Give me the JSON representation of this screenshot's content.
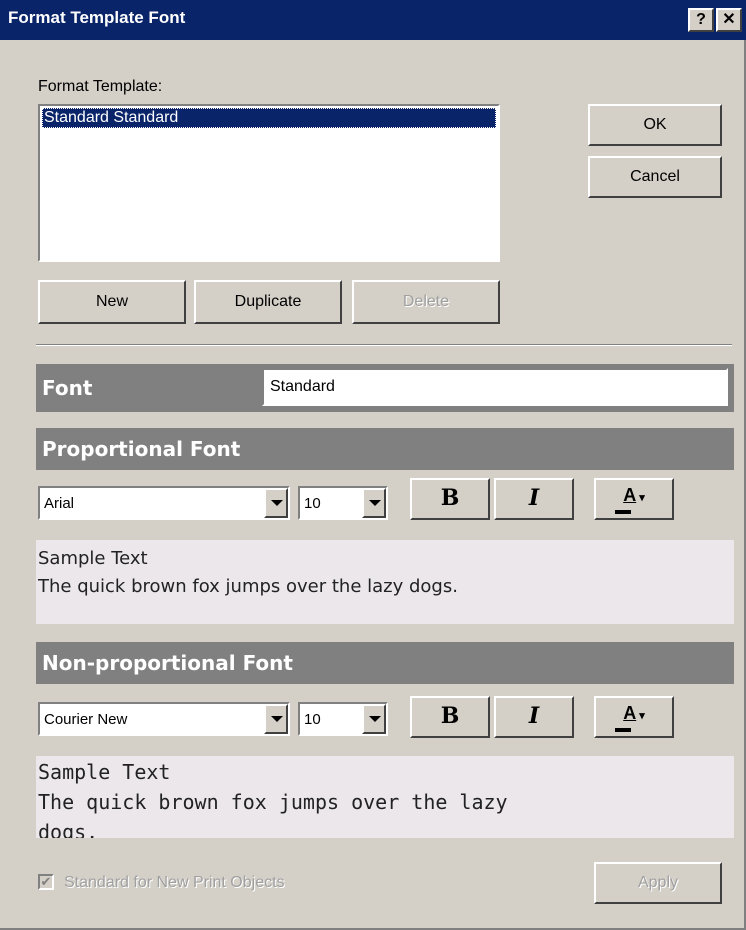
{
  "title": "Format Template Font",
  "titlebar": {
    "help_label": "?",
    "close_label": "✕"
  },
  "template_section": {
    "label": "Format Template:",
    "items": [
      "Standard Standard"
    ],
    "new_label": "New",
    "duplicate_label": "Duplicate",
    "delete_label": "Delete"
  },
  "ok_label": "OK",
  "cancel_label": "Cancel",
  "font": {
    "label": "Font",
    "value": "Standard"
  },
  "proportional": {
    "header": "Proportional Font",
    "font_name": "Arial",
    "size": "10",
    "bold_label": "B",
    "italic_label": "I",
    "color_label": "A",
    "sample_line1": "Sample Text",
    "sample_line2": "The quick brown fox jumps over the lazy dogs."
  },
  "nonproportional": {
    "header": "Non-proportional Font",
    "font_name": "Courier New",
    "size": "10",
    "bold_label": "B",
    "italic_label": "I",
    "color_label": "A",
    "sample_line1": "Sample Text",
    "sample_line2": "The quick brown fox jumps over the lazy",
    "sample_line3": "dogs."
  },
  "footer": {
    "checkbox_label": "Standard for New Print Objects",
    "checkbox_checked": true,
    "apply_label": "Apply"
  }
}
